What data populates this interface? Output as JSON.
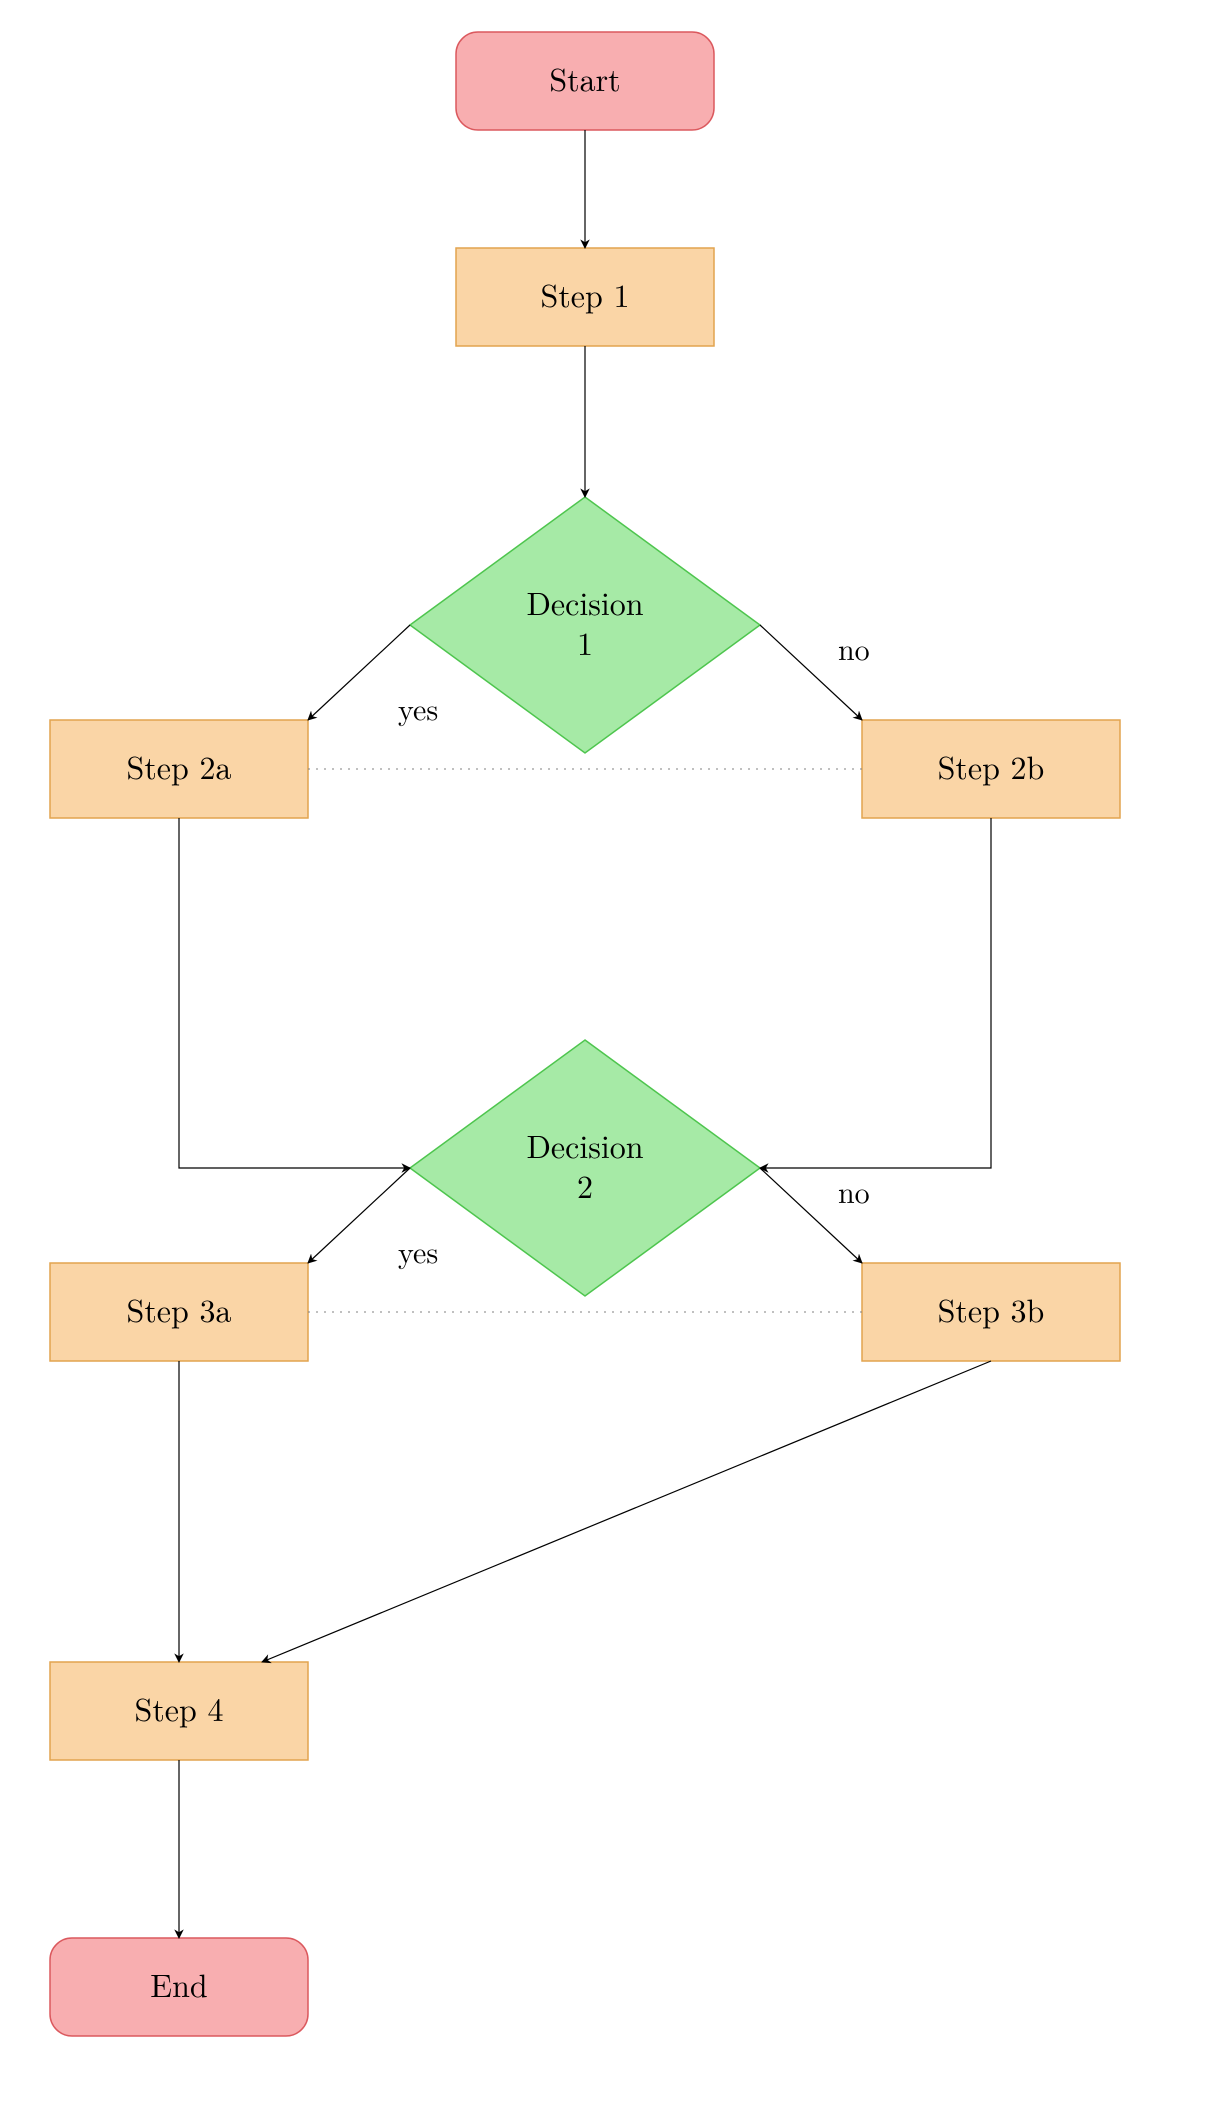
{
  "colors": {
    "startend_fill": "#f8aeb0",
    "startend_stroke": "#db595e",
    "process_fill": "#fad5a6",
    "process_stroke": "#e2a44f",
    "decision_fill": "#a6eaa6",
    "decision_stroke": "#4ec54e",
    "edge": "#000000",
    "dotted": "#808080"
  },
  "nodes": {
    "start": "Start",
    "step1": "Step 1",
    "dec1a": "Decision",
    "dec1b": "1",
    "step2a": "Step 2a",
    "step2b": "Step 2b",
    "dec2a": "Decision",
    "dec2b": "2",
    "step3a": "Step 3a",
    "step3b": "Step 3b",
    "step4": "Step 4",
    "end": "End"
  },
  "labels": {
    "yes": "yes",
    "no": "no"
  }
}
